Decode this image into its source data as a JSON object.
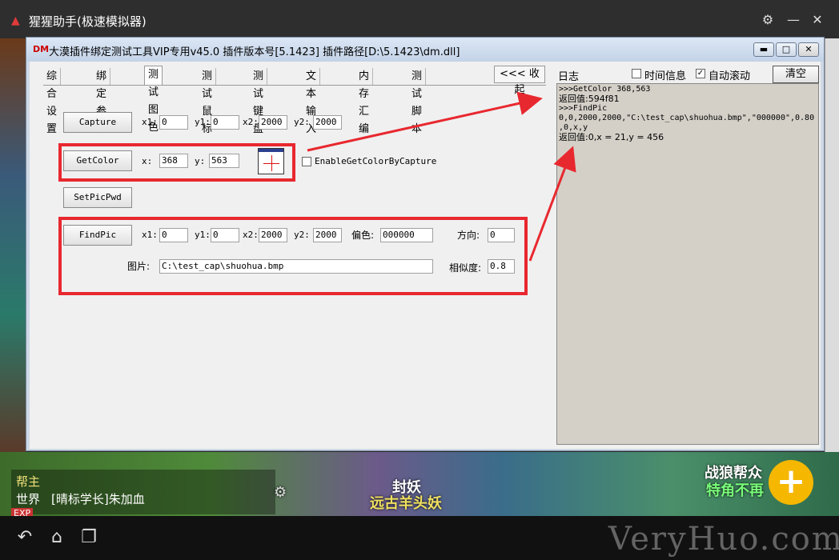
{
  "emulator": {
    "title": "猩猩助手(极速模拟器)",
    "colors": {
      "bar": "#2e2e2e",
      "accent": "#e03a3a"
    }
  },
  "dialog": {
    "badge": "DM",
    "title": "大漠插件绑定测试工具VIP专用v45.0 插件版本号[5.1423] 插件路径[D:\\5.1423\\dm.dll]",
    "tabs": [
      "综合设置",
      "绑定参数",
      "测试图色",
      "测试鼠标",
      "测试键盘",
      "文本输入",
      "内存汇编",
      "测试脚本"
    ],
    "active_tab": "测试图色",
    "collapse_label": "<<< 收起"
  },
  "capture": {
    "button": "Capture",
    "x1_label": "x1:",
    "x1": "0",
    "y1_label": "y1:",
    "y1": "0",
    "x2_label": "x2:",
    "x2": "2000",
    "y2_label": "y2:",
    "y2": "2000"
  },
  "getcolor": {
    "button": "GetColor",
    "x_label": "x:",
    "x": "368",
    "y_label": "y:",
    "y": "563",
    "enable_label": "EnableGetColorByCapture",
    "enable_checked": false
  },
  "setpicpwd": {
    "button": "SetPicPwd"
  },
  "findpic": {
    "button": "FindPic",
    "x1_label": "x1:",
    "x1": "0",
    "y1_label": "y1:",
    "y1": "0",
    "x2_label": "x2:",
    "x2": "2000",
    "y2_label": "y2:",
    "y2": "2000",
    "delta_color_label": "偏色:",
    "delta_color": "000000",
    "dir_label": "方向:",
    "dir": "0",
    "pic_label": "图片:",
    "pic": "C:\\test_cap\\shuohua.bmp",
    "sim_label": "相似度:",
    "sim": "0.8"
  },
  "log": {
    "label": "日志",
    "time_info_label": "时间信息",
    "time_info_checked": false,
    "auto_scroll_label": "自动滚动",
    "auto_scroll_checked": true,
    "clear_label": "清空",
    "lines": [
      ">>>GetColor 368,563",
      "返回值:594f81",
      ">>>FindPic",
      "0,0,2000,2000,\"C:\\test_cap\\shuohua.bmp\",\"000000\",0.80",
      ",0,x,y",
      "返回值:0,x = 21,y = 456"
    ]
  },
  "game": {
    "chat_1": "帮主",
    "chat_2": "世界",
    "chat_2_text": "[晴标学长]朱加血",
    "exp": "EXP",
    "label_1": "封妖",
    "label_2": "远古羊头妖",
    "label_3": "战狼帮众",
    "label_4": "特角不再"
  },
  "navbar": {
    "watermark": "VeryHuo.com"
  },
  "highlight_color": "#e8282f"
}
